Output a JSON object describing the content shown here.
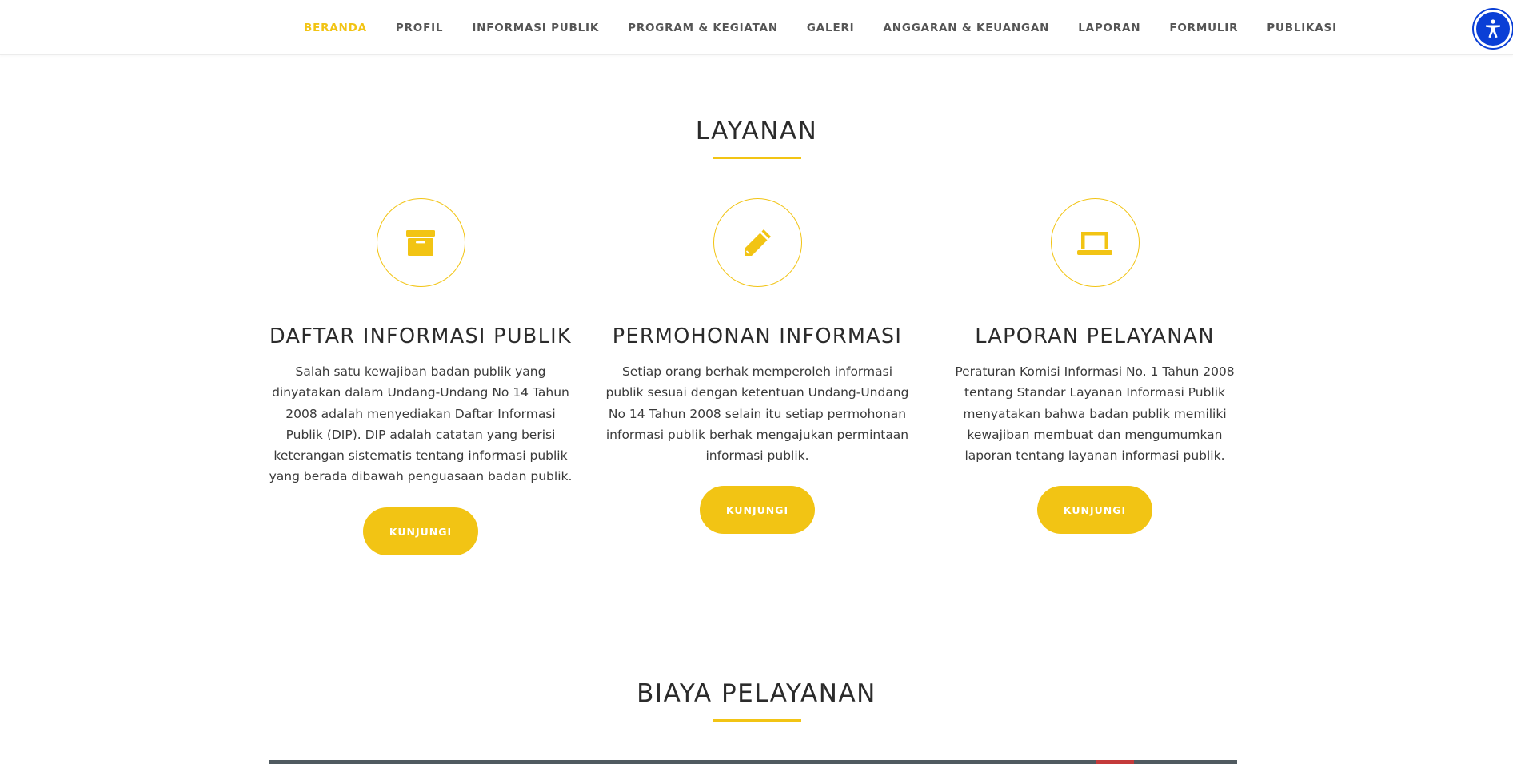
{
  "nav": {
    "items": [
      {
        "label": "BERANDA",
        "active": true
      },
      {
        "label": "PROFIL",
        "active": false
      },
      {
        "label": "INFORMASI PUBLIK",
        "active": false
      },
      {
        "label": "PROGRAM & KEGIATAN",
        "active": false
      },
      {
        "label": "GALERI",
        "active": false
      },
      {
        "label": "ANGGARAN & KEUANGAN",
        "active": false
      },
      {
        "label": "LAPORAN",
        "active": false
      },
      {
        "label": "FORMULIR",
        "active": false
      },
      {
        "label": "PUBLIKASI",
        "active": false
      }
    ],
    "accessibility_icon": "accessibility-icon"
  },
  "layanan": {
    "title": "LAYANAN",
    "cards": [
      {
        "icon": "archive-box-icon",
        "title": "DAFTAR INFORMASI PUBLIK",
        "description": "Salah satu kewajiban badan publik yang dinyatakan dalam Undang-Undang No 14 Tahun 2008 adalah menyediakan Daftar Informasi Publik (DIP). DIP adalah catatan yang berisi keterangan sistematis tentang informasi publik yang berada dibawah penguasaan badan publik.",
        "button_label": "KUNJUNGI"
      },
      {
        "icon": "pencil-icon",
        "title": "PERMOHONAN INFORMASI",
        "description": "Setiap orang berhak memperoleh informasi publik sesuai dengan ketentuan Undang-Undang No 14 Tahun 2008 selain itu setiap permohonan informasi publik berhak mengajukan permintaan informasi publik.",
        "button_label": "KUNJUNGI"
      },
      {
        "icon": "laptop-icon",
        "title": "LAPORAN PELAYANAN",
        "description": "Peraturan Komisi Informasi No. 1 Tahun 2008 tentang Standar Layanan Informasi Publik menyatakan bahwa badan publik memiliki kewajiban membuat dan mengumumkan laporan tentang layanan informasi publik.",
        "button_label": "KUNJUNGI"
      }
    ]
  },
  "biaya": {
    "title": "BIAYA PELAYANAN"
  },
  "colors": {
    "accent": "#f2c414",
    "nav_text": "#555555",
    "heading": "#2b2b2b",
    "body_text": "#3a3a3a",
    "accessibility_button": "#0a3fd6"
  }
}
